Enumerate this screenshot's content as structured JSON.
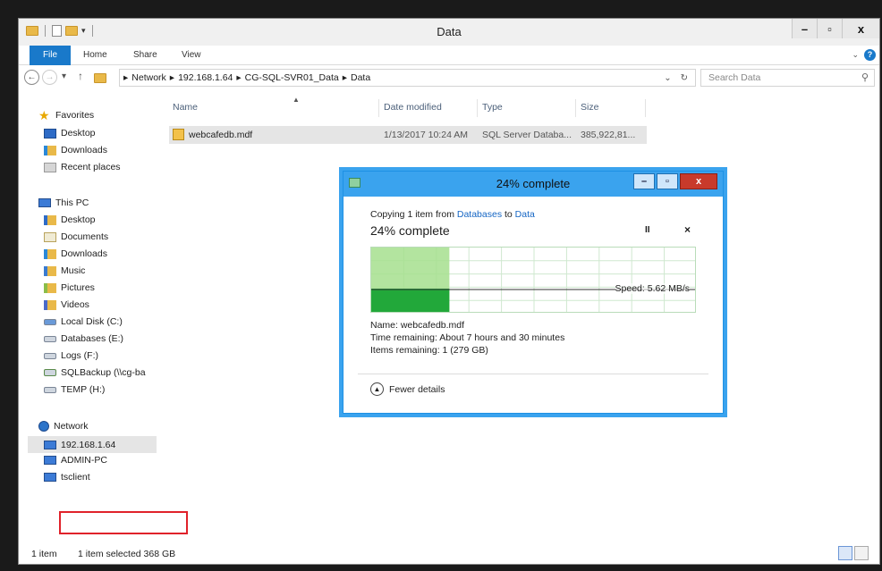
{
  "window": {
    "title": "Data",
    "controls": {
      "minimize": "–",
      "maximize": "▫",
      "close": "x"
    }
  },
  "ribbon": {
    "tabs": [
      "File",
      "Home",
      "Share",
      "View"
    ]
  },
  "address": {
    "path": [
      "Network",
      "192.168.1.64",
      "CG-SQL-SVR01_Data",
      "Data"
    ],
    "search_placeholder": "Search Data"
  },
  "nav": {
    "favorites": {
      "label": "Favorites",
      "items": [
        "Desktop",
        "Downloads",
        "Recent places"
      ]
    },
    "this_pc": {
      "label": "This PC",
      "items": [
        "Desktop",
        "Documents",
        "Downloads",
        "Music",
        "Pictures",
        "Videos",
        "Local Disk (C:)",
        "Databases (E:)",
        "Logs (F:)",
        "SQLBackup (\\\\cg-ba",
        "TEMP (H:)"
      ]
    },
    "network": {
      "label": "Network",
      "items": [
        "192.168.1.64",
        "ADMIN-PC",
        "tsclient"
      ]
    }
  },
  "columns": [
    "Name",
    "Date modified",
    "Type",
    "Size"
  ],
  "files": [
    {
      "name": "webcafedb.mdf",
      "date": "1/13/2017 10:24 AM",
      "type": "SQL Server Databa...",
      "size": "385,922,81..."
    }
  ],
  "status": {
    "count": "1 item",
    "selection": "1 item selected  368 GB"
  },
  "dialog": {
    "title": "24% complete",
    "copy_prefix": "Copying 1 item from ",
    "source": "Databases",
    "copy_mid": " to ",
    "dest": "Data",
    "percent_text": "24% complete",
    "progress": 0.24,
    "speed": "Speed: 5.62 MB/s",
    "name_line": "Name: webcafedb.mdf",
    "time_line": "Time remaining: About 7 hours and 30 minutes",
    "items_line": "Items remaining: 1 (279 GB)",
    "fewer_details": "Fewer details",
    "pause_glyph": "II",
    "cancel_glyph": "×",
    "controls": {
      "minimize": "–",
      "maximize": "▫",
      "close": "x"
    }
  },
  "colors": {
    "accent": "#1979ca",
    "dialog_frame": "#3aa3ee",
    "graph_fill": "#a6df8e",
    "graph_speed": "#22a83a",
    "highlight_box": "#e0222a"
  }
}
